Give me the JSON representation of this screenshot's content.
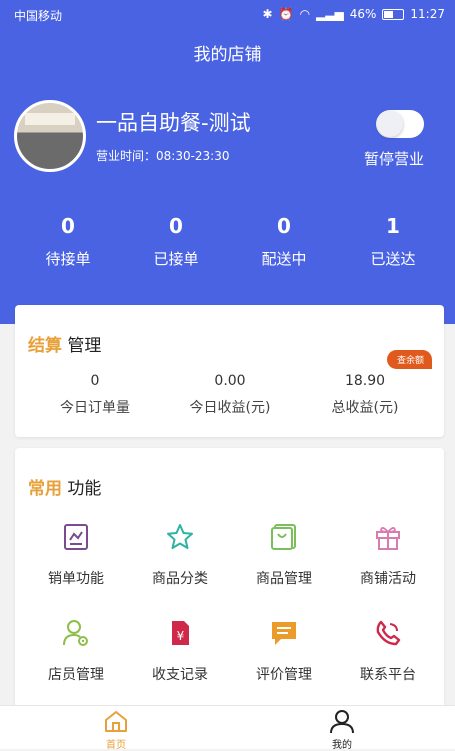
{
  "status_bar": {
    "carrier": "中国移动",
    "battery": "46%",
    "time": "11:27"
  },
  "header": {
    "title": "我的店铺"
  },
  "shop": {
    "name": "一品自助餐-测试",
    "hours": "营业时间：08:30-23:30",
    "toggle_label": "暂停营业"
  },
  "order_stats": [
    {
      "value": "0",
      "label": "待接单"
    },
    {
      "value": "0",
      "label": "已接单"
    },
    {
      "value": "0",
      "label": "配送中"
    },
    {
      "value": "1",
      "label": "已送达"
    }
  ],
  "settlement": {
    "title_accent": "结算",
    "title_rest": " 管理",
    "badge": "查余额",
    "items": [
      {
        "value": "0",
        "label": "今日订单量"
      },
      {
        "value": "0.00",
        "label": "今日收益(元)"
      },
      {
        "value": "18.90",
        "label": "总收益(元)"
      }
    ]
  },
  "functions": {
    "title_accent": "常用",
    "title_rest": " 功能",
    "items": [
      {
        "label": "销单功能",
        "icon": "chart-icon",
        "color": "#7a4b8e"
      },
      {
        "label": "商品分类",
        "icon": "star-icon",
        "color": "#2bb3a3"
      },
      {
        "label": "商品管理",
        "icon": "bag-icon",
        "color": "#7bbf5a"
      },
      {
        "label": "商铺活动",
        "icon": "gift-icon",
        "color": "#d77bb0"
      },
      {
        "label": "店员管理",
        "icon": "staff-gear-icon",
        "color": "#8cbf4a"
      },
      {
        "label": "收支记录",
        "icon": "yuan-doc-icon",
        "color": "#d0284b"
      },
      {
        "label": "评价管理",
        "icon": "message-icon",
        "color": "#ec9a2a"
      },
      {
        "label": "联系平台",
        "icon": "phone-icon",
        "color": "#d0284b"
      }
    ]
  },
  "tabbar": {
    "home": "首页",
    "mine": "我的",
    "active_color": "#e8a13a"
  }
}
